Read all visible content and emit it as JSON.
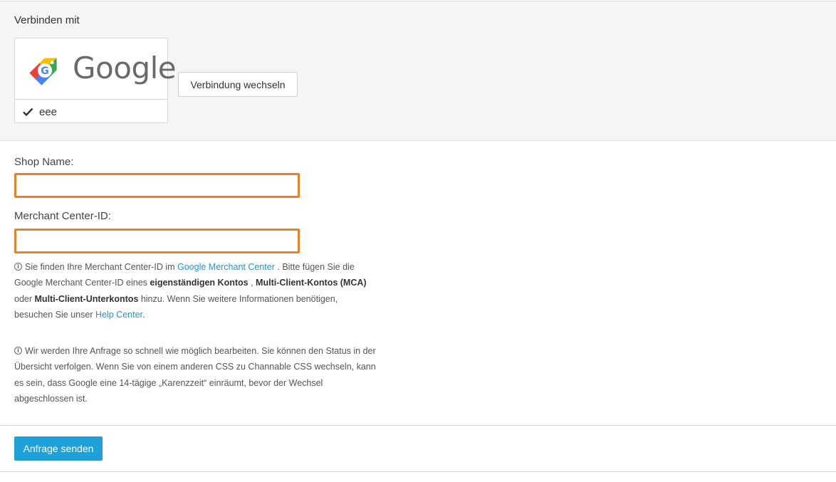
{
  "connect": {
    "title": "Verbinden mit",
    "provider_name": "Google",
    "account_name": "eee",
    "switch_label": "Verbindung wechseln"
  },
  "form": {
    "shop_name_label": "Shop Name:",
    "shop_name_value": "",
    "merchant_id_label": "Merchant Center-ID:",
    "merchant_id_value": ""
  },
  "info1": {
    "t1": "Sie finden Ihre Merchant Center-ID im",
    "link1": "Google Merchant Center",
    "t2": ". Bitte fügen Sie die Google Merchant Center-ID eines",
    "b1": "eigenständigen Kontos",
    "t3": ",",
    "b2": "Multi-Client-Kontos (MCA)",
    "t4": "oder",
    "b3": "Multi-Client-Unterkontos",
    "t5": "hinzu. Wenn Sie weitere Informationen benötigen, besuchen Sie unser",
    "link2": "Help Center",
    "t6": "."
  },
  "info2": {
    "text": "Wir werden Ihre Anfrage so schnell wie möglich bearbeiten. Sie können den Status in der Übersicht verfolgen. Wenn Sie von einem anderen CSS zu Channable CSS wechseln, kann es sein, dass Google eine 14-tägige „Karenzzeit“ einräumt, bevor der Wechsel abgeschlossen ist."
  },
  "actions": {
    "submit_label": "Anfrage senden"
  },
  "icons": {
    "logo": "google-shopping-tag-icon",
    "status": "check-icon",
    "info": "info-icon"
  },
  "colors": {
    "accent": "#1ea0d8",
    "link": "#2a93c9",
    "input_highlight": "#e8822a",
    "section_bg": "#f5f5f5"
  }
}
